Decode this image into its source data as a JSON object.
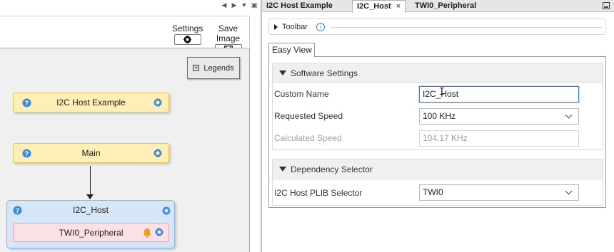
{
  "left_toolbar": {
    "settings_label": "Settings",
    "save_image_label": "Save Image"
  },
  "canvas": {
    "legends_label": "Legends",
    "nodes": {
      "host_example": "I2C Host Example",
      "main": "Main",
      "group_title": "I2C_Host",
      "inner": "TWI0_Peripheral"
    },
    "colors": {
      "component_fill": "#fdefb5",
      "group_fill": "#d6e6f7",
      "peripheral_fill": "#fbe1e6",
      "icon_blue": "#3c8ad8",
      "warning_orange": "#f29a1a"
    }
  },
  "tabs": [
    {
      "label": "I2C Host Example",
      "active": false
    },
    {
      "label": "I2C_Host",
      "active": true,
      "close": "×"
    },
    {
      "label": "TWI0_Peripheral",
      "active": false
    }
  ],
  "toolbar": {
    "label": "Toolbar",
    "info_glyph": "i"
  },
  "view": {
    "tab_label": "Easy View"
  },
  "software_settings": {
    "title": "Software Settings",
    "custom_name": {
      "label": "Custom Name",
      "value": "I2C_Host"
    },
    "requested_speed": {
      "label": "Requested Speed",
      "value": "100 KHz"
    },
    "calculated_speed": {
      "label": "Calculated Speed",
      "value": "104.17 KHz"
    }
  },
  "dependency_selector": {
    "title": "Dependency Selector",
    "plib": {
      "label": "I2C Host PLIB Selector",
      "value": "TWI0"
    }
  }
}
